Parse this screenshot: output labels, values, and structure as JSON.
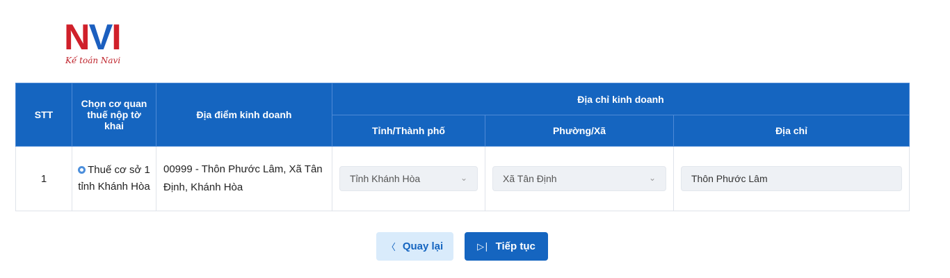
{
  "logo": {
    "mark_n": "N",
    "mark_v": "V",
    "mark_i": "I",
    "tagline": "Kế toán Navi"
  },
  "table": {
    "headers": {
      "stt": "STT",
      "agency": "Chọn cơ quan thuế nộp tờ khai",
      "place": "Địa điểm kinh doanh",
      "address_group": "Địa chỉ kinh doanh",
      "province": "Tỉnh/Thành phố",
      "ward": "Phường/Xã",
      "address": "Địa chỉ"
    },
    "rows": [
      {
        "stt": "1",
        "agency": "Thuế cơ sở 1 tỉnh Khánh Hòa",
        "place": "00999 - Thôn Phước Lâm, Xã Tân Định, Khánh Hòa",
        "province": "Tỉnh Khánh Hòa",
        "ward": "Xã Tân Định",
        "address": "Thôn Phước Lâm"
      }
    ]
  },
  "buttons": {
    "back_label": "Quay lại",
    "next_label": "Tiếp tục",
    "back_icon": "chevron-left-icon",
    "next_icon": "skip-forward-icon"
  },
  "colors": {
    "header_bg": "#1565c0",
    "back_bg": "#d9ebfb",
    "next_bg": "#1565c0",
    "logo_red": "#d0202a",
    "logo_blue": "#1c5fbf"
  }
}
